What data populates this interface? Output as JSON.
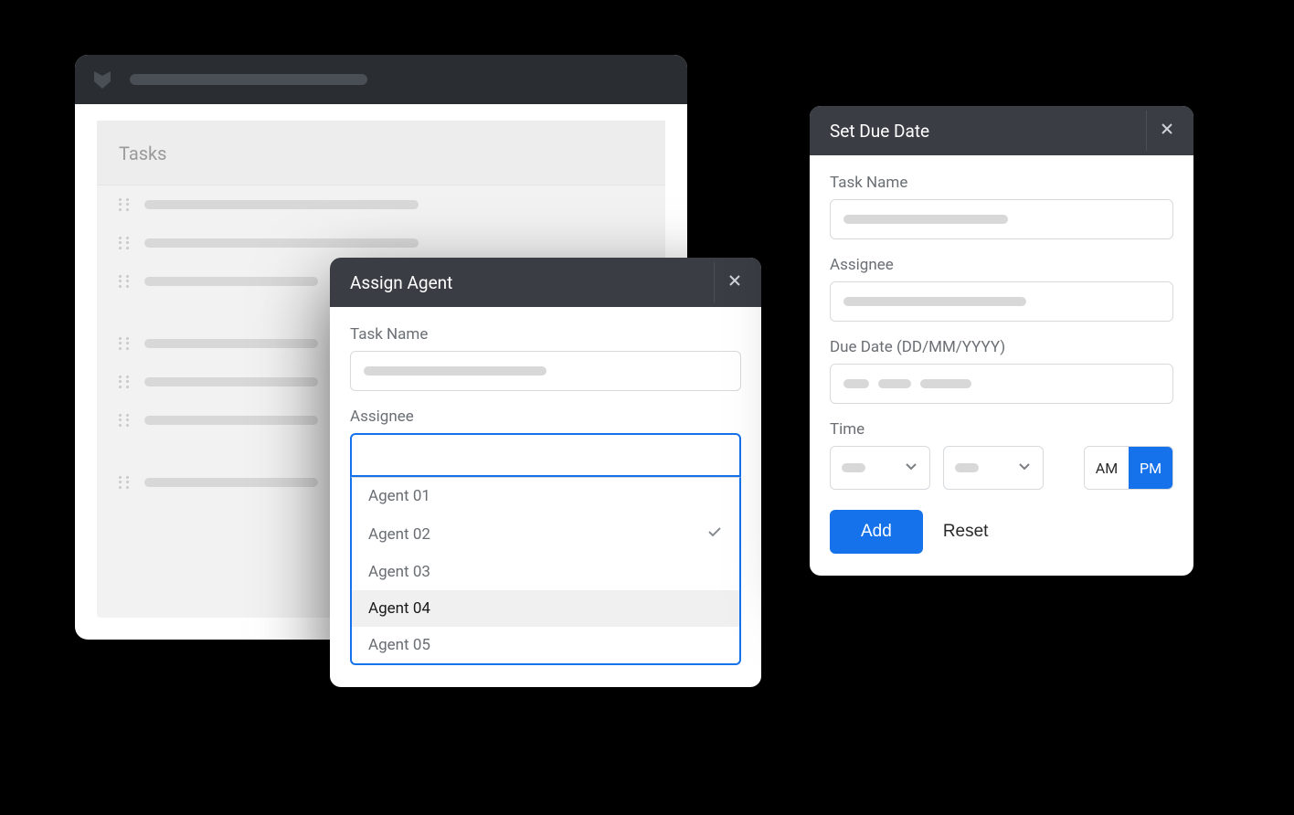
{
  "app": {
    "section_title": "Tasks"
  },
  "assign_modal": {
    "title": "Assign Agent",
    "task_name_label": "Task Name",
    "assignee_label": "Assignee",
    "options": [
      {
        "label": "Agent 01",
        "selected": false,
        "hovered": false
      },
      {
        "label": "Agent 02",
        "selected": true,
        "hovered": false
      },
      {
        "label": "Agent 03",
        "selected": false,
        "hovered": false
      },
      {
        "label": "Agent 04",
        "selected": false,
        "hovered": true
      },
      {
        "label": "Agent 05",
        "selected": false,
        "hovered": false
      }
    ]
  },
  "due_modal": {
    "title": "Set Due Date",
    "task_name_label": "Task Name",
    "assignee_label": "Assignee",
    "due_date_label": "Due Date (DD/MM/YYYY)",
    "time_label": "Time",
    "am_label": "AM",
    "pm_label": "PM",
    "active_period": "PM",
    "add_label": "Add",
    "reset_label": "Reset"
  }
}
